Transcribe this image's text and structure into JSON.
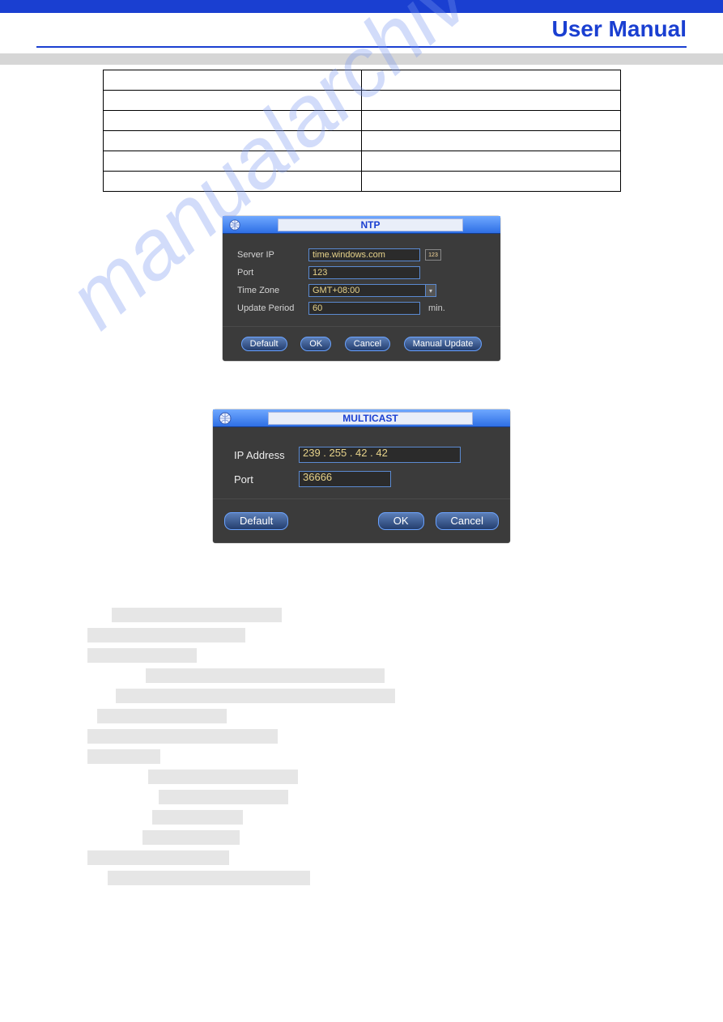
{
  "header": {
    "title": "User Manual"
  },
  "watermark": "manualarchive.com",
  "ntp_dialog": {
    "title": "NTP",
    "fields": {
      "server_ip_label": "Server IP",
      "server_ip_value": "time.windows.com",
      "port_label": "Port",
      "port_value": "123",
      "time_zone_label": "Time Zone",
      "time_zone_value": "GMT+08:00",
      "update_period_label": "Update Period",
      "update_period_value": "60",
      "update_period_unit": "min."
    },
    "keypad_icon_text": "123",
    "buttons": {
      "default": "Default",
      "ok": "OK",
      "cancel": "Cancel",
      "manual": "Manual Update"
    }
  },
  "multicast_dialog": {
    "title": "MULTICAST",
    "fields": {
      "ip_label": "IP Address",
      "ip_value": "239   .   255   .   42    .   42",
      "port_label": "Port",
      "port_value": "36666"
    },
    "buttons": {
      "default": "Default",
      "ok": "OK",
      "cancel": "Cancel"
    }
  }
}
